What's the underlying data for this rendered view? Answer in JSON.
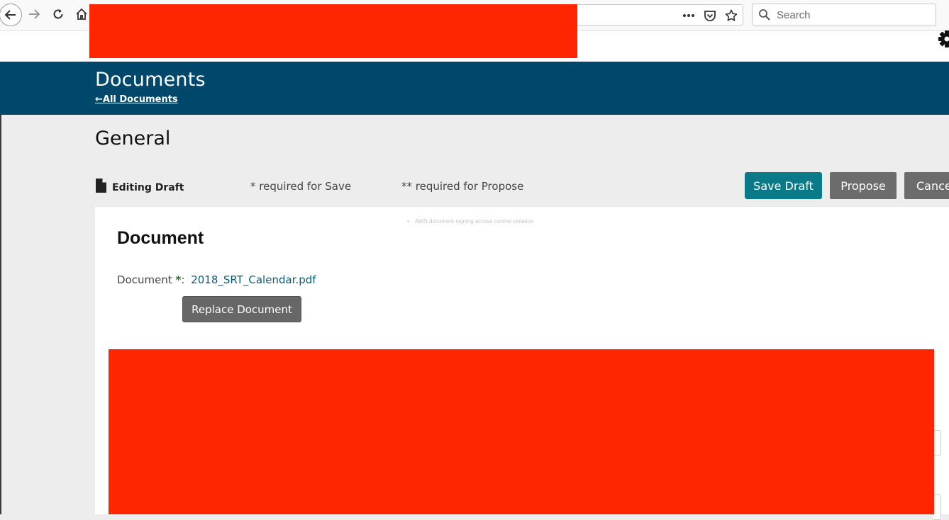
{
  "browser": {
    "search_placeholder": "Search"
  },
  "header": {
    "title": "Documents",
    "back_link": "←All Documents"
  },
  "section": {
    "title": "General"
  },
  "status": {
    "editing_label": "Editing Draft",
    "required_save": "* required for Save",
    "required_propose": "** required for Propose"
  },
  "actions": {
    "save_draft": "Save Draft",
    "propose": "Propose",
    "cancel": "Cancel"
  },
  "document": {
    "heading": "Document",
    "field_label": "Document ",
    "required_mark": "*",
    "colon": ":",
    "file_name": "2018_SRT_Calendar.pdf",
    "replace_button": "Replace Document",
    "note": "AWS document signing access control violation"
  },
  "colors": {
    "banner": "#00476c",
    "save_button": "#0b7a88",
    "secondary_button": "#6c6c6c",
    "redaction": "#ff2500"
  }
}
